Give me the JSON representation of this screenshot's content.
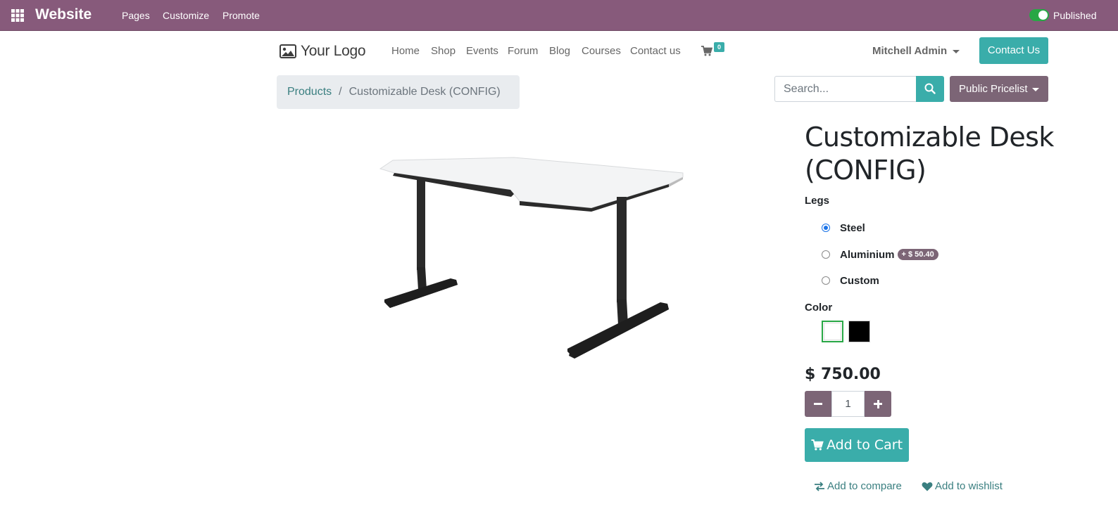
{
  "admin_bar": {
    "app_title": "Website",
    "menu": [
      "Pages",
      "Customize",
      "Promote"
    ],
    "published_label": "Published",
    "published": true,
    "accent_color": "#875a7b"
  },
  "navbar": {
    "logo_text": "Your Logo",
    "items": [
      "Home",
      "Shop",
      "Events",
      "Forum",
      "Blog",
      "Courses",
      "Contact us"
    ],
    "cart_count": "0",
    "user_name": "Mitchell Admin",
    "contact_button": "Contact Us"
  },
  "breadcrumb": {
    "link": "Products",
    "separator": "/",
    "current": "Customizable Desk (CONFIG)"
  },
  "search": {
    "placeholder": "Search..."
  },
  "pricelist": {
    "label": "Public Pricelist"
  },
  "product": {
    "name": "Customizable Desk (CONFIG)",
    "attributes": {
      "legs_title": "Legs",
      "legs_options": [
        {
          "label": "Steel",
          "checked": true
        },
        {
          "label": "Aluminium",
          "extra": "+ $ 50.40",
          "checked": false
        },
        {
          "label": "Custom",
          "checked": false
        }
      ],
      "color_title": "Color",
      "colors": [
        "#ffffff",
        "#000000"
      ],
      "selected_color": "#ffffff"
    },
    "price": "$ 750.00",
    "quantity": "1",
    "add_to_cart": "Add to Cart",
    "add_to_compare": "Add to compare",
    "add_to_wishlist": "Add to wishlist"
  },
  "colors": {
    "primary": "#3aadaa",
    "secondary": "#7c6576",
    "link": "#3a7f80"
  }
}
